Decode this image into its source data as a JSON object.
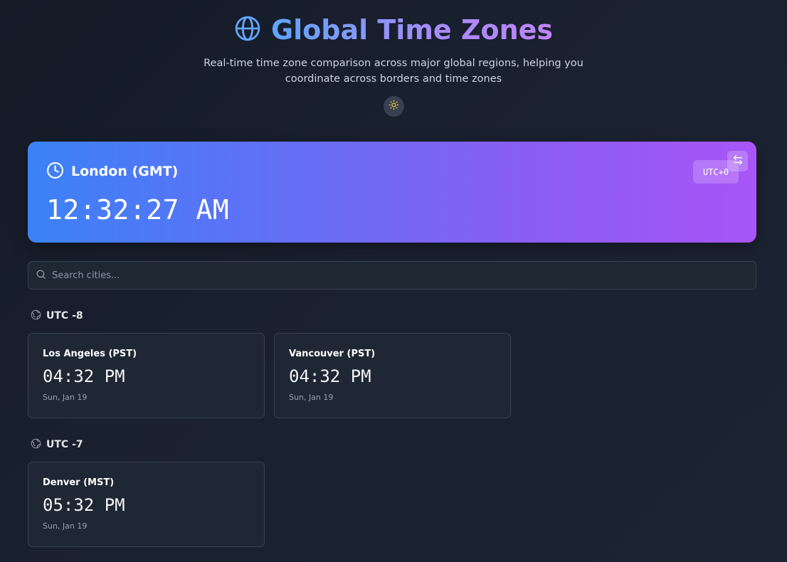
{
  "header": {
    "title": "Global Time Zones",
    "subtitle": "Real-time time zone comparison across major global regions, helping you coordinate across borders and time zones",
    "theme_icon": "sun-icon",
    "globe_icon": "globe-icon"
  },
  "hero": {
    "city": "London (GMT)",
    "time": "12:32:27 AM",
    "utc_badge": "UTC+0",
    "clock_icon": "clock-icon",
    "swap_icon": "swap-icon"
  },
  "search": {
    "placeholder": "Search cities...",
    "value": ""
  },
  "groups": [
    {
      "label": "UTC -8",
      "cities": [
        {
          "city": "Los Angeles (PST)",
          "time": "04:32 PM",
          "date": "Sun, Jan 19"
        },
        {
          "city": "Vancouver (PST)",
          "time": "04:32 PM",
          "date": "Sun, Jan 19"
        }
      ]
    },
    {
      "label": "UTC -7",
      "cities": [
        {
          "city": "Denver (MST)",
          "time": "05:32 PM",
          "date": "Sun, Jan 19"
        }
      ]
    }
  ],
  "colors": {
    "accent_blue": "#3b82f6",
    "accent_purple": "#a855f7",
    "background": "#1a2130"
  }
}
